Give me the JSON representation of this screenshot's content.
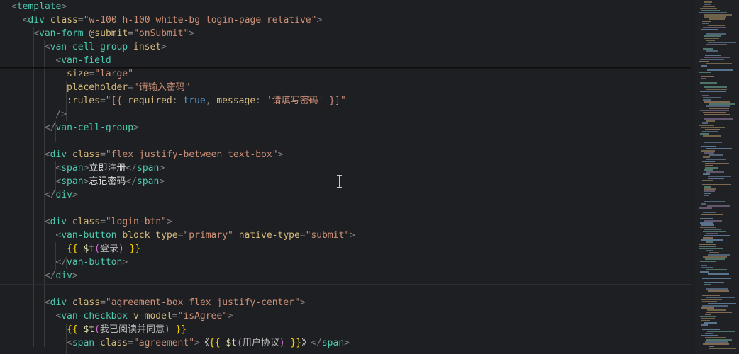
{
  "editor": {
    "lines": [
      {
        "indent": 0,
        "tokens": [
          [
            "punc",
            "<"
          ],
          [
            "tag",
            "template"
          ],
          [
            "punc",
            ">"
          ]
        ]
      },
      {
        "indent": 1,
        "tokens": [
          [
            "punc",
            "<"
          ],
          [
            "tag",
            "div"
          ],
          [
            "attr",
            " class"
          ],
          [
            "punc",
            "="
          ],
          [
            "str",
            "\"w-100 h-100 white-bg login-page relative\""
          ],
          [
            "punc",
            ">"
          ]
        ]
      },
      {
        "indent": 2,
        "tokens": [
          [
            "punc",
            "<"
          ],
          [
            "tag",
            "van-form"
          ],
          [
            "attr",
            " @submit"
          ],
          [
            "punc",
            "="
          ],
          [
            "str",
            "\"onSubmit\""
          ],
          [
            "punc",
            ">"
          ]
        ]
      },
      {
        "indent": 3,
        "tokens": [
          [
            "punc",
            "<"
          ],
          [
            "tag",
            "van-cell-group"
          ],
          [
            "attr",
            " inset"
          ],
          [
            "punc",
            ">"
          ]
        ]
      },
      {
        "indent": 4,
        "tokens": [
          [
            "punc",
            "<"
          ],
          [
            "tag",
            "van-field"
          ]
        ]
      },
      {
        "indent": 5,
        "tokens": [
          [
            "attr",
            "size"
          ],
          [
            "punc",
            "="
          ],
          [
            "str",
            "\"large\""
          ]
        ]
      },
      {
        "indent": 5,
        "tokens": [
          [
            "attr",
            "placeholder"
          ],
          [
            "punc",
            "="
          ],
          [
            "str",
            "\"请输入密码\""
          ]
        ]
      },
      {
        "indent": 5,
        "tokens": [
          [
            "attr",
            ":rules"
          ],
          [
            "punc",
            "="
          ],
          [
            "str",
            "\"[{ "
          ],
          [
            "attr",
            "required"
          ],
          [
            "punc",
            ": "
          ],
          [
            "kw",
            "true"
          ],
          [
            "punc",
            ", "
          ],
          [
            "attr",
            "message"
          ],
          [
            "punc",
            ": "
          ],
          [
            "str",
            "'请填写密码' }]\""
          ]
        ]
      },
      {
        "indent": 4,
        "tokens": [
          [
            "punc",
            "/>"
          ]
        ]
      },
      {
        "indent": 3,
        "tokens": [
          [
            "punc",
            "</"
          ],
          [
            "tag",
            "van-cell-group"
          ],
          [
            "punc",
            ">"
          ]
        ]
      },
      {
        "indent": 0,
        "tokens": []
      },
      {
        "indent": 3,
        "tokens": [
          [
            "punc",
            "<"
          ],
          [
            "tag",
            "div"
          ],
          [
            "attr",
            " class"
          ],
          [
            "punc",
            "="
          ],
          [
            "str",
            "\"flex justify-between text-box\""
          ],
          [
            "punc",
            ">"
          ]
        ]
      },
      {
        "indent": 4,
        "tokens": [
          [
            "punc",
            "<"
          ],
          [
            "tag",
            "span"
          ],
          [
            "punc",
            ">"
          ],
          [
            "txt",
            "立即注册"
          ],
          [
            "punc",
            "</"
          ],
          [
            "tag",
            "span"
          ],
          [
            "punc",
            ">"
          ]
        ]
      },
      {
        "indent": 4,
        "tokens": [
          [
            "punc",
            "<"
          ],
          [
            "tag",
            "span"
          ],
          [
            "punc",
            ">"
          ],
          [
            "txt",
            "忘记密码"
          ],
          [
            "punc",
            "</"
          ],
          [
            "tag",
            "span"
          ],
          [
            "punc",
            ">"
          ]
        ]
      },
      {
        "indent": 3,
        "tokens": [
          [
            "punc",
            "</"
          ],
          [
            "tag",
            "div"
          ],
          [
            "punc",
            ">"
          ]
        ]
      },
      {
        "indent": 0,
        "tokens": []
      },
      {
        "indent": 3,
        "tokens": [
          [
            "punc",
            "<"
          ],
          [
            "tag",
            "div"
          ],
          [
            "attr",
            " class"
          ],
          [
            "punc",
            "="
          ],
          [
            "str",
            "\"login-btn\""
          ],
          [
            "punc",
            ">"
          ]
        ]
      },
      {
        "indent": 4,
        "tokens": [
          [
            "punc",
            "<"
          ],
          [
            "tag",
            "van-button"
          ],
          [
            "attr",
            " block type"
          ],
          [
            "punc",
            "="
          ],
          [
            "str",
            "\"primary\""
          ],
          [
            "attr",
            " native-type"
          ],
          [
            "punc",
            "="
          ],
          [
            "str",
            "\"submit\""
          ],
          [
            "punc",
            ">"
          ]
        ]
      },
      {
        "indent": 5,
        "tokens": [
          [
            "brace",
            "{{ "
          ],
          [
            "fn",
            "$t"
          ],
          [
            "paren",
            "("
          ],
          [
            "cn",
            "登录"
          ],
          [
            "paren",
            ")"
          ],
          [
            "brace",
            " }}"
          ]
        ]
      },
      {
        "indent": 4,
        "tokens": [
          [
            "punc",
            "</"
          ],
          [
            "tag",
            "van-button"
          ],
          [
            "punc",
            ">"
          ]
        ]
      },
      {
        "indent": 3,
        "tokens": [
          [
            "punc",
            "</"
          ],
          [
            "tag",
            "div"
          ],
          [
            "punc",
            ">"
          ]
        ]
      },
      {
        "indent": 0,
        "tokens": []
      },
      {
        "indent": 3,
        "tokens": [
          [
            "punc",
            "<"
          ],
          [
            "tag",
            "div"
          ],
          [
            "attr",
            " class"
          ],
          [
            "punc",
            "="
          ],
          [
            "str",
            "\"agreement-box flex justify-center\""
          ],
          [
            "punc",
            ">"
          ]
        ]
      },
      {
        "indent": 4,
        "tokens": [
          [
            "punc",
            "<"
          ],
          [
            "tag",
            "van-checkbox"
          ],
          [
            "attr",
            " v-model"
          ],
          [
            "punc",
            "="
          ],
          [
            "str",
            "\"isAgree\""
          ],
          [
            "punc",
            ">"
          ]
        ]
      },
      {
        "indent": 5,
        "tokens": [
          [
            "brace",
            "{{ "
          ],
          [
            "fn",
            "$t"
          ],
          [
            "paren",
            "("
          ],
          [
            "cn",
            "我已阅读并同意"
          ],
          [
            "paren",
            ")"
          ],
          [
            "brace",
            " }}"
          ]
        ]
      },
      {
        "indent": 5,
        "tokens": [
          [
            "punc",
            "<"
          ],
          [
            "tag",
            "span"
          ],
          [
            "attr",
            " class"
          ],
          [
            "punc",
            "="
          ],
          [
            "str",
            "\"agreement\""
          ],
          [
            "punc",
            ">"
          ],
          [
            "txt",
            "《"
          ],
          [
            "brace",
            "{{ "
          ],
          [
            "fn",
            "$t"
          ],
          [
            "paren",
            "("
          ],
          [
            "cn",
            "用户协议"
          ],
          [
            "paren",
            ")"
          ],
          [
            "brace",
            " }}"
          ],
          [
            "txt",
            "》"
          ],
          [
            "punc",
            "</"
          ],
          [
            "tag",
            "span"
          ],
          [
            "punc",
            ">"
          ]
        ]
      }
    ]
  },
  "colors": {
    "background": "#1e1f22",
    "tag": "#4ec9b0",
    "attribute": "#d7ba7d",
    "string": "#ce9178",
    "keyword": "#569cd6"
  }
}
